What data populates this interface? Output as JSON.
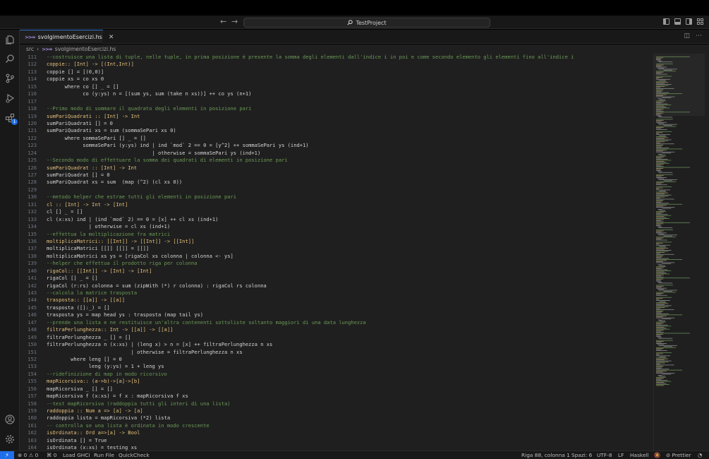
{
  "titlebar": {
    "search": "TestProject",
    "back_icon": "←",
    "forward_icon": "→"
  },
  "tab": {
    "name": "svolgimentoEsercizi.hs",
    "icon": ">>="
  },
  "breadcrumb": {
    "folder": "src",
    "file": "svolgimentoEsercizi.hs"
  },
  "editor": {
    "lines": [
      {
        "n": "111",
        "t": "--costruisce una lista di tuple, nelle tuple, in prima posizione è presente la somma degli elementi dall'indice i in poi e come secondo elemento gli elementi fino all'indice i",
        "k": "cmt"
      },
      {
        "n": "112",
        "t": "coppie:: [Int] -> [(Int,Int)]",
        "k": "sig"
      },
      {
        "n": "113",
        "t": "coppie [] = [(0,0)]",
        "k": ""
      },
      {
        "n": "114",
        "t": "coppie xs = co xs 0",
        "k": ""
      },
      {
        "n": "115",
        "t": "      where co [] _ = []",
        "k": ""
      },
      {
        "n": "116",
        "t": "            co (y:ys) n = [(sum ys, sum (take n xs))] ++ co ys (n+1)",
        "k": ""
      },
      {
        "n": "117",
        "t": "",
        "k": ""
      },
      {
        "n": "118",
        "t": "--Primo modo di sommare il quadrato degli elementi in posizione pari",
        "k": "cmt"
      },
      {
        "n": "119",
        "t": "sumPariQuadrati :: [Int] -> Int",
        "k": "sig"
      },
      {
        "n": "120",
        "t": "sumPariQuadrati [] = 0",
        "k": ""
      },
      {
        "n": "121",
        "t": "sumPariQuadrati xs = sum (sommaSePari xs 0)",
        "k": ""
      },
      {
        "n": "122",
        "t": "      where sommaSePari [] _ = []",
        "k": ""
      },
      {
        "n": "123",
        "t": "            sommaSePari (y:ys) ind | ind `mod` 2 == 0 = [y^2] ++ sommaSePari ys (ind+1)",
        "k": ""
      },
      {
        "n": "124",
        "t": "                                   | otherwise = sommaSePari ys (ind+1)",
        "k": ""
      },
      {
        "n": "125",
        "t": "--Secondo modo di effettuare la somma dei quadrati di elementi in posizione pari",
        "k": "cmt"
      },
      {
        "n": "126",
        "t": "sumPariQuadrat :: [Int] -> Int",
        "k": "sig"
      },
      {
        "n": "127",
        "t": "sumPariQuadrat [] = 0",
        "k": ""
      },
      {
        "n": "128",
        "t": "sumPariQuadrat xs = sum  (map (^2) (cl xs 0))",
        "k": ""
      },
      {
        "n": "129",
        "t": "",
        "k": ""
      },
      {
        "n": "130",
        "t": "--metodo helper che estrae tutti gli elementi in posizione pari",
        "k": "cmt"
      },
      {
        "n": "131",
        "t": "cl :: [Int] -> Int -> [Int]",
        "k": "sig"
      },
      {
        "n": "132",
        "t": "cl [] _ = []",
        "k": ""
      },
      {
        "n": "133",
        "t": "cl (x:xs) ind | (ind `mod` 2) == 0 = [x] ++ cl xs (ind+1)",
        "k": ""
      },
      {
        "n": "134",
        "t": "              | otherwise = cl xs (ind+1)",
        "k": ""
      },
      {
        "n": "135",
        "t": "--effettua la moltiplicazione fra matrici",
        "k": "cmt"
      },
      {
        "n": "136",
        "t": "moltiplicaMatrici:: [[Int]] -> [[Int]] -> [[Int]]",
        "k": "sig"
      },
      {
        "n": "137",
        "t": "moltiplicaMatrici [[]] [[]] = [[]]",
        "k": ""
      },
      {
        "n": "138",
        "t": "moltiplicaMatrici xs ys = [rigaCol xs colonna | colonna <- ys]",
        "k": ""
      },
      {
        "n": "139",
        "t": "--helper che effettua il prodotto riga per colonna",
        "k": "cmt"
      },
      {
        "n": "140",
        "t": "rigaCol:: [[Int]] -> [Int] -> [Int]",
        "k": "sig"
      },
      {
        "n": "141",
        "t": "rigaCol [] _ = []",
        "k": ""
      },
      {
        "n": "142",
        "t": "rigaCol (r:rs) colonna = sum (zipWith (*) r colonna) : rigaCol rs colonna",
        "k": ""
      },
      {
        "n": "143",
        "t": "--calcola la matrice trasposta",
        "k": "cmt"
      },
      {
        "n": "144",
        "t": "trasposta:: [[a]] -> [[a]]",
        "k": "sig"
      },
      {
        "n": "145",
        "t": "trasposta ([]:_) = []",
        "k": ""
      },
      {
        "n": "146",
        "t": "trasposta ys = map head ys : trasposta (map tail ys)",
        "k": ""
      },
      {
        "n": "147",
        "t": "--prende una lista e ne restituisce un'altra contenenti sottoliste soltanto maggiori di una data lunghezza",
        "k": "cmt"
      },
      {
        "n": "148",
        "t": "filtraPerlunghezza:: Int -> [[a]] -> [[a]]",
        "k": "sig"
      },
      {
        "n": "149",
        "t": "filtraPerlunghezza _ [] = []",
        "k": ""
      },
      {
        "n": "150",
        "t": "filtraPerlunghezza n (x:xs) | (leng x) > n = [x] ++ filtraPerlunghezza n xs",
        "k": ""
      },
      {
        "n": "151",
        "t": "                            | otherwise = filtraPerlunghezza n xs",
        "k": ""
      },
      {
        "n": "152",
        "t": "        where leng [] = 0",
        "k": ""
      },
      {
        "n": "153",
        "t": "              leng (y:ys) = 1 + leng ys",
        "k": ""
      },
      {
        "n": "154",
        "t": "--ridefinizione di map in modo ricorsivo",
        "k": "cmt"
      },
      {
        "n": "155",
        "t": "mapRicorsiva:: (a->b)->[a]->[b]",
        "k": "sig"
      },
      {
        "n": "156",
        "t": "mapRicorsiva _ [] = []",
        "k": ""
      },
      {
        "n": "157",
        "t": "mapRicorsiva f (x:xs) = f x : mapRicorsiva f xs",
        "k": ""
      },
      {
        "n": "158",
        "t": "--test mapRicorsiva (raddoppia tutti gli interi di una lista)",
        "k": "cmt"
      },
      {
        "n": "159",
        "t": "raddoppia :: Num a => [a] -> [a]",
        "k": "sig"
      },
      {
        "n": "160",
        "t": "raddoppia lista = mapRicorsiva (*2) lista",
        "k": ""
      },
      {
        "n": "161",
        "t": "-- controlla se una lista è ordinata in modo crescente",
        "k": "cmt"
      },
      {
        "n": "162",
        "t": "isOrdinata:: Ord a=>[a] -> Bool",
        "k": "sig"
      },
      {
        "n": "163",
        "t": "isOrdinata [] = True",
        "k": ""
      },
      {
        "n": "164",
        "t": "isOrdinata (x:xs) = testing xs",
        "k": ""
      }
    ]
  },
  "activity": {
    "extensions_badge": "1"
  },
  "statusbar": {
    "remote": "⚡",
    "errors": "⊗ 0 ⚠ 0",
    "ports": "⌘ 0",
    "load_ghci": "Load GHCi",
    "run_file": "Run File",
    "quickcheck": "QuickCheck",
    "position": "Riga 88, colonna 1",
    "spaces": "Spazi: 6",
    "encoding": "UTF-8",
    "eol": "LF",
    "language": "Haskell",
    "prettier": "⊘ Prettier"
  }
}
